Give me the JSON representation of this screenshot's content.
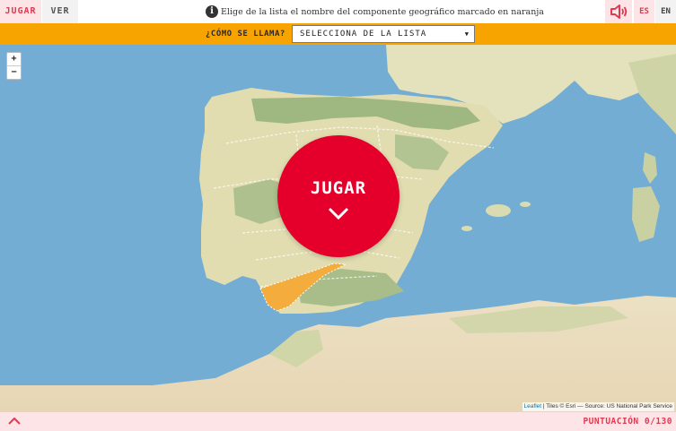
{
  "header": {
    "tab_play": "JUGAR",
    "tab_view": "VER",
    "instruction": "Elige de la lista el nombre del componente geográfico marcado en naranja",
    "info_icon": "info-icon",
    "sound_icon": "speaker-icon",
    "lang_es": "ES",
    "lang_en": "EN"
  },
  "question": {
    "label": "¿CÓMO SE LLAMA?",
    "select_value": "SELECCIONA DE LA LISTA"
  },
  "map": {
    "zoom_in": "+",
    "zoom_out": "−",
    "attribution_link": "Leaflet",
    "attribution_text": " | Tiles © Esri — Source: US National Park Service"
  },
  "play_button": {
    "label": "JUGAR",
    "icon": "chevron-down-icon"
  },
  "footer": {
    "collapse_icon": "chevron-up-icon",
    "score_label": "PUNTUACIÓN",
    "score_value": "0/130"
  },
  "colors": {
    "accent_red": "#e4002b",
    "question_bar": "#f7a300",
    "highlight_region": "#f4ad3d",
    "sea": "#74add3",
    "land": "#e3dfb1"
  }
}
